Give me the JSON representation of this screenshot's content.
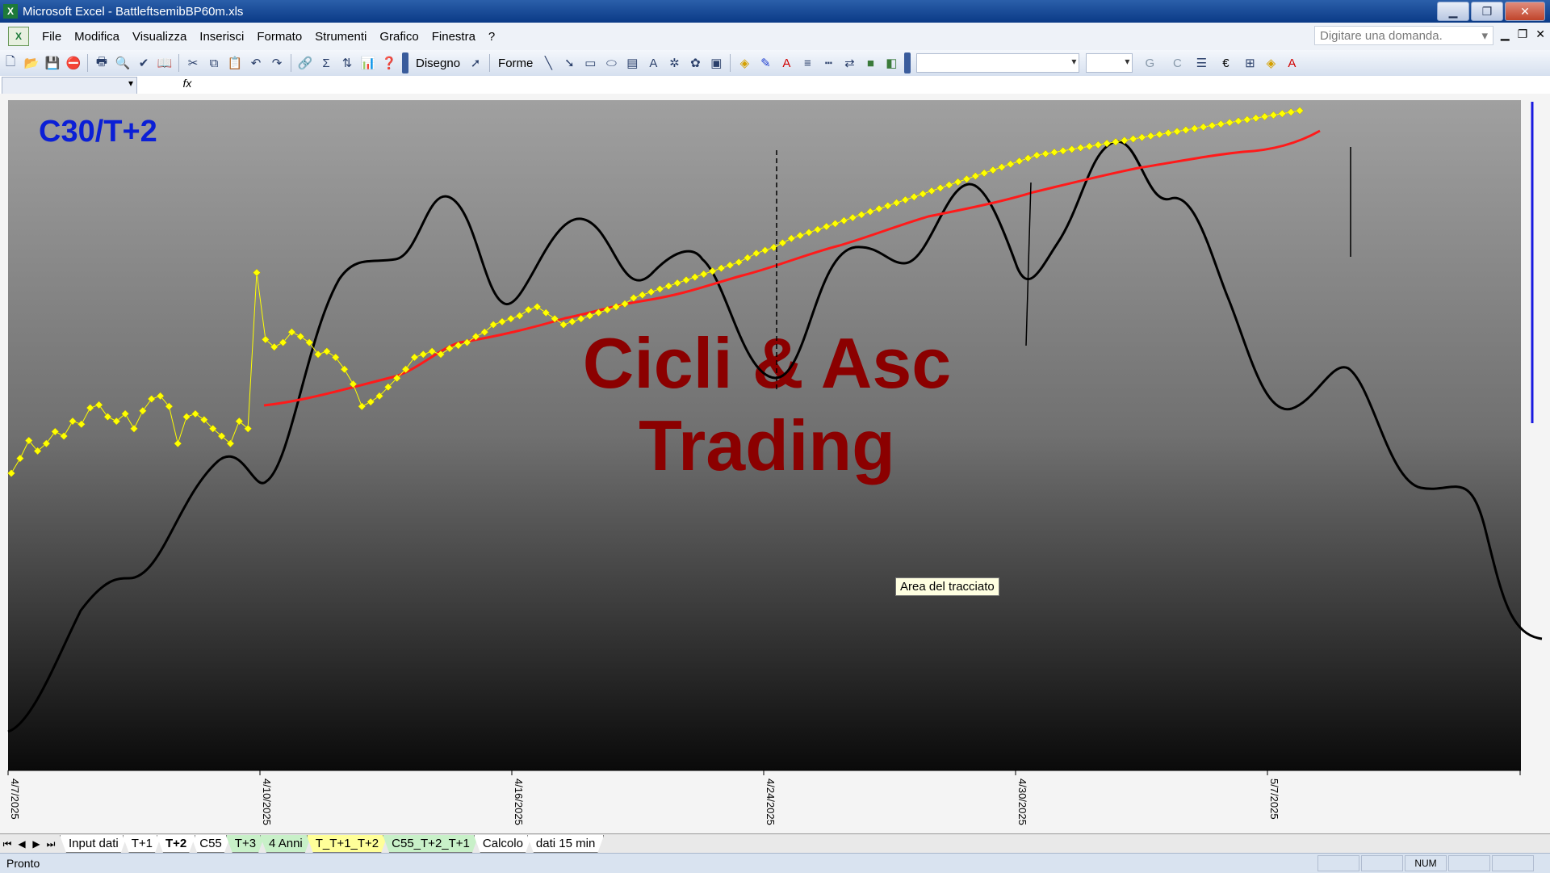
{
  "window": {
    "app_icon": "X",
    "title": "Microsoft Excel - BattleftsemibBP60m.xls",
    "buttons": [
      "minimize-icon",
      "restore-icon",
      "close-icon"
    ]
  },
  "menu": {
    "doc_icon": "X",
    "items": [
      {
        "label": "File"
      },
      {
        "label": "Modifica"
      },
      {
        "label": "Visualizza"
      },
      {
        "label": "Inserisci"
      },
      {
        "label": "Formato"
      },
      {
        "label": "Strumenti"
      },
      {
        "label": "Grafico"
      },
      {
        "label": "Finestra"
      },
      {
        "label": "?"
      }
    ],
    "ask_placeholder": "Digitare una domanda."
  },
  "toolbar": {
    "drawing_label": "Disegno",
    "shapes_label": "Forme",
    "bold_label": "G",
    "italic_label": "C",
    "euro": "€"
  },
  "chart": {
    "overlay_title": "C30/T+2",
    "watermark_line1": "Cicli & Asc",
    "watermark_line2": "Trading",
    "tooltip": "Area del tracciato",
    "colors": {
      "title": "#0b1fd6",
      "watermark": "#8b0000",
      "yellow": "#ffff00",
      "red": "#ff1a1a",
      "black": "#000000",
      "blue_line": "#1a1adf"
    }
  },
  "chart_data": {
    "type": "line",
    "x_tick_labels": [
      "4/7/2025",
      "4/10/2025",
      "4/16/2025",
      "4/24/2025",
      "4/30/2025",
      "5/7/2025"
    ],
    "series": [
      {
        "marker": "diamond",
        "color": "#ffff00",
        "values": [
          -0.4,
          -0.3,
          -0.18,
          -0.25,
          -0.2,
          -0.12,
          -0.15,
          -0.05,
          -0.07,
          0.04,
          0.06,
          -0.02,
          -0.05,
          0.0,
          -0.1,
          0.02,
          0.1,
          0.12,
          0.05,
          -0.2,
          -0.02,
          0.0,
          -0.04,
          -0.1,
          -0.15,
          -0.2,
          -0.05,
          -0.1,
          0.95,
          0.5,
          0.45,
          0.48,
          0.55,
          0.52,
          0.48,
          0.4,
          0.42,
          0.38,
          0.3,
          0.2,
          0.05,
          0.08,
          0.12,
          0.18,
          0.24,
          0.3,
          0.38,
          0.4,
          0.42,
          0.4,
          0.44,
          0.46,
          0.48,
          0.52,
          0.55,
          0.6,
          0.62,
          0.64,
          0.66,
          0.7,
          0.72,
          0.68,
          0.64,
          0.6,
          0.62,
          0.64,
          0.66,
          0.68,
          0.7,
          0.72,
          0.74,
          0.78,
          0.8,
          0.82,
          0.84,
          0.86,
          0.88,
          0.9,
          0.92,
          0.94,
          0.96,
          0.98,
          1.0,
          1.02,
          1.05,
          1.08,
          1.1,
          1.12,
          1.15,
          1.18,
          1.2,
          1.22,
          1.24,
          1.26,
          1.28,
          1.3,
          1.32,
          1.34,
          1.36,
          1.38,
          1.4,
          1.42,
          1.44,
          1.46,
          1.48,
          1.5,
          1.52,
          1.54,
          1.56,
          1.58,
          1.6,
          1.62,
          1.64,
          1.66,
          1.68,
          1.7,
          1.72,
          1.74,
          1.75,
          1.76,
          1.77,
          1.78,
          1.79,
          1.8,
          1.81,
          1.82,
          1.83,
          1.84,
          1.85,
          1.86,
          1.87,
          1.88,
          1.89,
          1.9,
          1.91,
          1.92,
          1.93,
          1.94,
          1.95,
          1.96,
          1.97,
          1.98,
          1.99,
          2.0,
          2.01,
          2.02,
          2.03,
          2.04
        ]
      }
    ]
  },
  "sheet_nav": [
    "⏮",
    "◀",
    "▶",
    "⏭"
  ],
  "sheet_tabs": [
    {
      "label": "Input dati",
      "color": "#ffffff"
    },
    {
      "label": "T+1",
      "color": "#ffffff"
    },
    {
      "label": "T+2",
      "color": "#ffffff",
      "active": true
    },
    {
      "label": "C55",
      "color": "#ffffff"
    },
    {
      "label": "T+3",
      "color": "#c8f0c8"
    },
    {
      "label": "4 Anni",
      "color": "#c8f0c8"
    },
    {
      "label": "T_T+1_T+2",
      "color": "#ffff99"
    },
    {
      "label": "C55_T+2_T+1",
      "color": "#c8f0c8"
    },
    {
      "label": "Calcolo",
      "color": "#ffffff"
    },
    {
      "label": "dati 15 min",
      "color": "#ffffff"
    }
  ],
  "status": {
    "text": "Pronto",
    "num": "NUM"
  }
}
